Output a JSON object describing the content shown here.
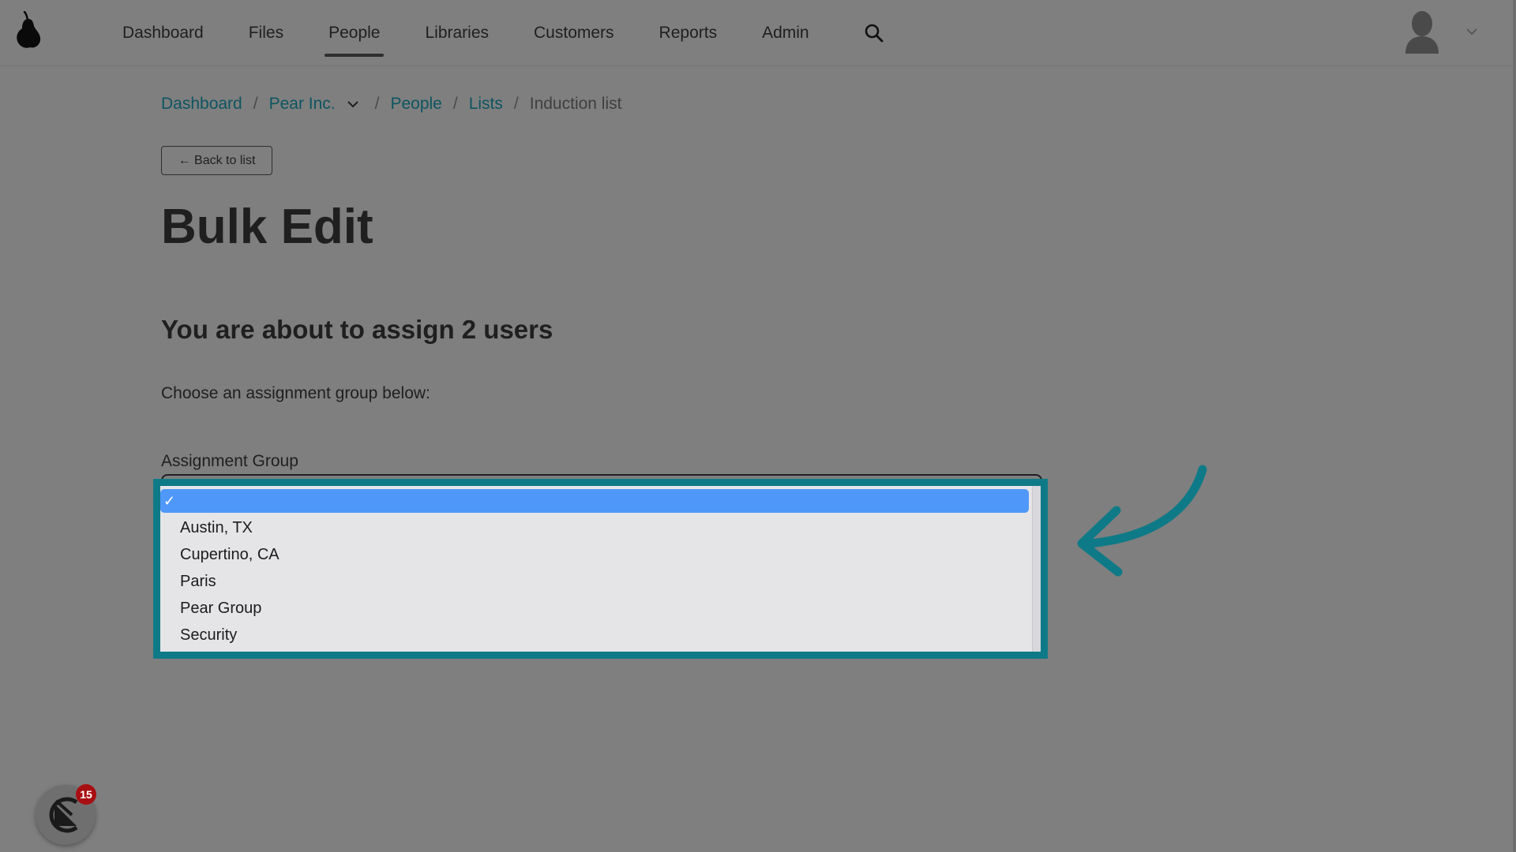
{
  "nav": {
    "items": [
      {
        "label": "Dashboard"
      },
      {
        "label": "Files"
      },
      {
        "label": "People"
      },
      {
        "label": "Libraries"
      },
      {
        "label": "Customers"
      },
      {
        "label": "Reports"
      },
      {
        "label": "Admin"
      }
    ],
    "active": "People",
    "search_icon": "search-icon",
    "avatar_icon": "user-avatar-icon"
  },
  "breadcrumb": {
    "dashboard": "Dashboard",
    "org": "Pear Inc.",
    "people": "People",
    "lists": "Lists",
    "current": "Induction list",
    "separator": "/"
  },
  "back_button": "← Back to list",
  "title": "Bulk Edit",
  "subtitle": "You are about to assign 2 users",
  "instruction": "Choose an assignment group below:",
  "field": {
    "label": "Assignment Group",
    "selected_value": "",
    "options": [
      "Austin, TX",
      "Cupertino, CA",
      "Paris",
      "Pear Group",
      "Security"
    ]
  },
  "widget": {
    "badge_count": "15"
  },
  "colors": {
    "highlight": "#0f7a87",
    "selected_option": "#4f98fa",
    "link": "#0d5560",
    "badge": "#a80f12",
    "overlay": "#7f7f7f"
  }
}
